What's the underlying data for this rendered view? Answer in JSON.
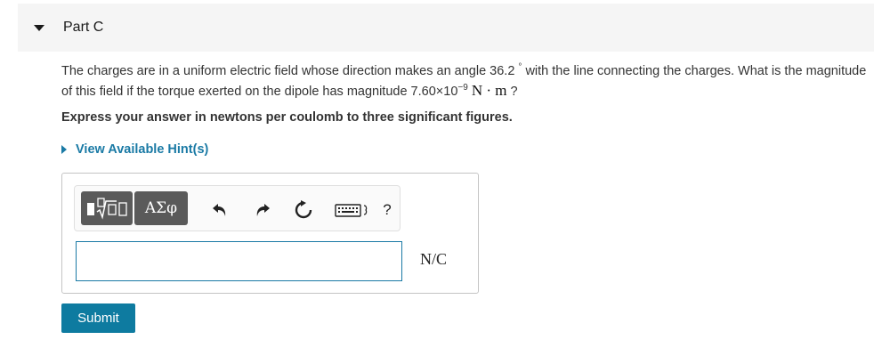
{
  "part": {
    "title": "Part C"
  },
  "question": {
    "text_1": "The charges are in a uniform electric field whose direction makes an angle 36.2",
    "degree": "°",
    "text_2": "with the line connecting the charges. What is the magnitude of this field if the torque exerted on the dipole has magnitude 7.60×10",
    "exponent": "−9",
    "units": "N · m",
    "end": "?"
  },
  "instruction": "Express your answer in newtons per coulomb to three significant figures.",
  "hint": {
    "label": "View Available Hint(s)"
  },
  "toolbar": {
    "greek_label": "ΑΣφ",
    "help_label": "?",
    "icons": [
      "templates-icon",
      "greek-symbols-icon",
      "undo-icon",
      "redo-icon",
      "reset-icon",
      "keyboard-icon",
      "help-icon"
    ]
  },
  "answer": {
    "value": "",
    "unit": "N/C"
  },
  "submit": {
    "label": "Submit"
  },
  "colors": {
    "accent": "#1a7aa5",
    "submit": "#0e7ba0",
    "toolbar_button": "#5a5a5a"
  }
}
